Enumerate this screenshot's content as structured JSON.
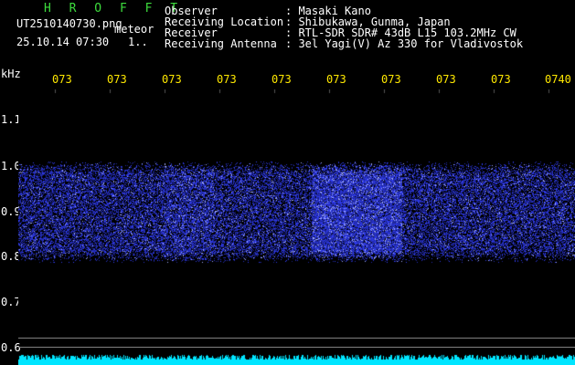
{
  "header": {
    "title": "H R O F F T",
    "filename": "UT2510140730.png",
    "mode": "meteor",
    "datetime": "25.10.14 07:30",
    "page": "1..",
    "fields": [
      {
        "label": "Observer",
        "value": ": Masaki Kano"
      },
      {
        "label": "Receiving Location",
        "value": ": Shibukawa, Gunma, Japan"
      },
      {
        "label": "Receiver",
        "value": ": RTL-SDR SDR# 43dB L15 103.2MHz CW"
      },
      {
        "label": "Receiving Antenna",
        "value": ": 3el Yagi(V) Az 330 for Vladivostok"
      }
    ]
  },
  "time_axis": {
    "labels": [
      "073",
      "073",
      "073",
      "073",
      "073",
      "073",
      "073",
      "073",
      "073",
      "0740"
    ]
  },
  "freq_axis": {
    "unit": "kHz",
    "labels": [
      "1.1",
      "1.0",
      "0.9",
      "0.8",
      "0.7",
      "0.6"
    ]
  },
  "colors": {
    "background": "#000000",
    "title": "#3ddc3d",
    "tick": "#ffe800",
    "signal": "#2a35ff",
    "noise": "#00e5ff"
  }
}
